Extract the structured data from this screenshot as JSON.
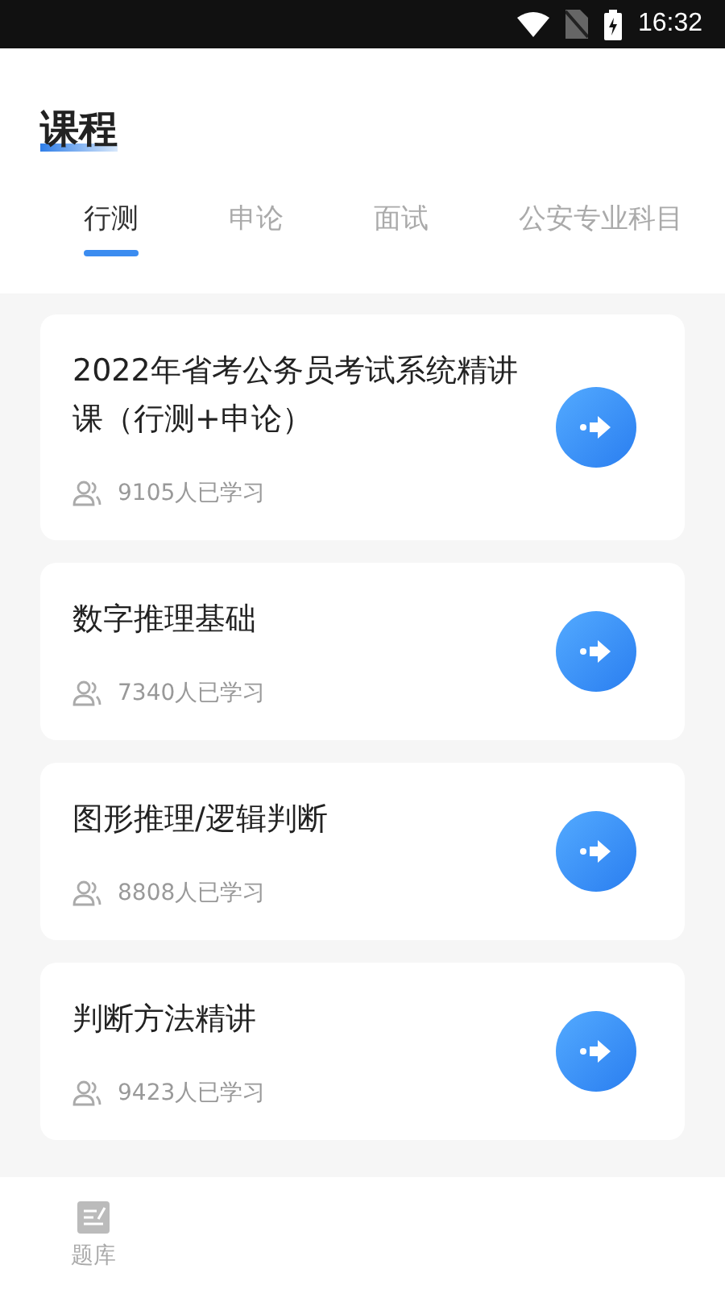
{
  "status_bar": {
    "time": "16:32"
  },
  "header": {
    "title": "课程"
  },
  "tabs": [
    {
      "label": "行测",
      "selected": true
    },
    {
      "label": "申论",
      "selected": false
    },
    {
      "label": "面试",
      "selected": false
    },
    {
      "label": "公安专业科目",
      "selected": false
    }
  ],
  "courses": [
    {
      "title": "2022年省考公务员考试系统精讲课（行测+申论）",
      "learners": "9105人已学习"
    },
    {
      "title": "数字推理基础",
      "learners": "7340人已学习"
    },
    {
      "title": "图形推理/逻辑判断",
      "learners": "8808人已学习"
    },
    {
      "title": "判断方法精讲",
      "learners": "9423人已学习"
    }
  ],
  "bottom_nav": [
    {
      "label": "题库",
      "selected": false
    }
  ]
}
